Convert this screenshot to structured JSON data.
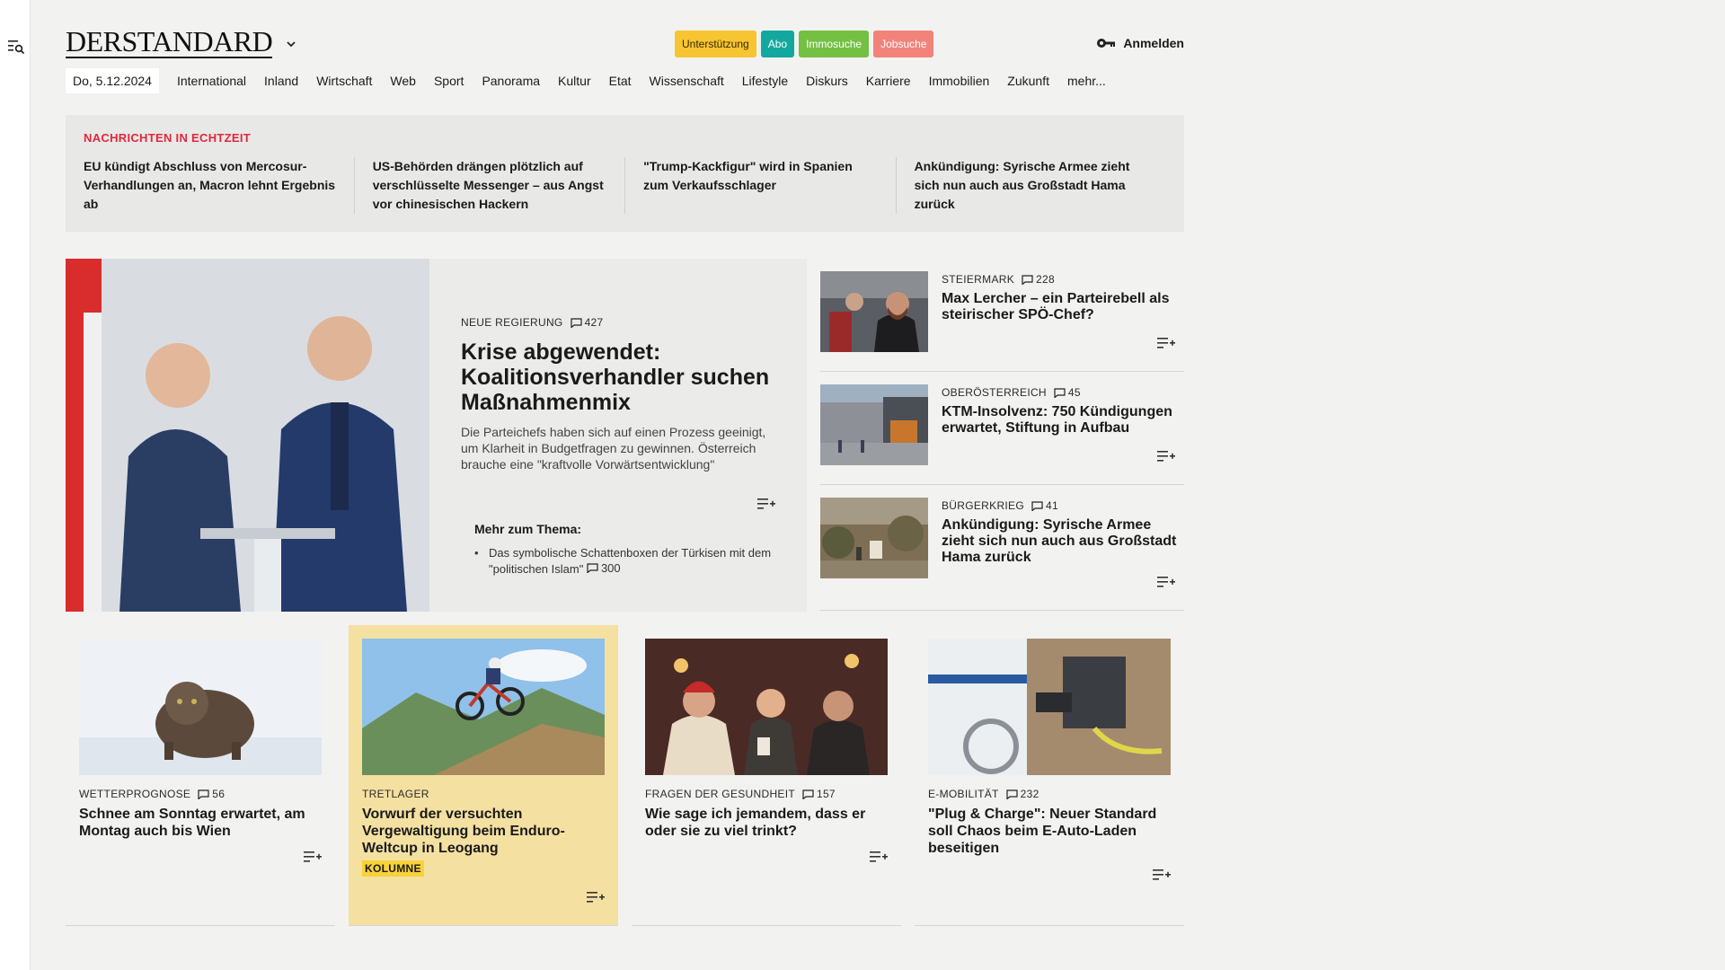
{
  "brand": {
    "logo": "DERSTANDARD"
  },
  "header": {
    "pills": [
      "Unterstützung",
      "Abo",
      "Immosuche",
      "Jobsuche"
    ],
    "login": "Anmelden"
  },
  "nav": {
    "date": "Do, 5.12.2024",
    "items": [
      "International",
      "Inland",
      "Wirtschaft",
      "Web",
      "Sport",
      "Panorama",
      "Kultur",
      "Etat",
      "Wissenschaft",
      "Lifestyle",
      "Diskurs",
      "Karriere",
      "Immobilien",
      "Zukunft",
      "mehr..."
    ]
  },
  "ticker": {
    "heading": "NACHRICHTEN IN ECHTZEIT",
    "items": [
      "EU kündigt Abschluss von Mercosur-Verhandlungen an, Macron lehnt Ergebnis ab",
      "US-Behörden drängen plötzlich auf verschlüsselte Messenger – aus Angst vor chinesischen Hackern",
      "\"Trump-Kackfigur\" wird in Spanien zum Verkaufsschlager",
      "Ankündigung: Syrische Armee zieht sich nun auch aus Großstadt Hama zurück"
    ]
  },
  "hero": {
    "kicker": "NEUE REGIERUNG",
    "comments": "427",
    "title": "Krise abgewendet: Koalitionsverhandler suchen Maßnahmenmix",
    "teaser": "Die Parteichefs haben sich auf einen Prozess geeinigt, um Klarheit in Budgetfragen zu gewinnen. Österreich brauche eine \"kraftvolle Vorwärtsentwicklung\"",
    "more_heading": "Mehr zum Thema:",
    "more_item": "Das symbolische Schattenboxen der Türkisen mit dem \"politischen Islam\"",
    "more_comments": "300"
  },
  "side": [
    {
      "kicker": "STEIERMARK",
      "comments": "228",
      "title": "Max Lercher – ein Parteirebell als steirischer SPÖ-Chef?"
    },
    {
      "kicker": "OBERÖSTERREICH",
      "comments": "45",
      "title": "KTM-Insolvenz: 750 Kündigungen erwartet, Stiftung in Aufbau"
    },
    {
      "kicker": "BÜRGERKRIEG",
      "comments": "41",
      "title": "Ankündigung: Syrische Armee zieht sich nun auch aus Großstadt Hama zurück"
    }
  ],
  "cards": [
    {
      "kicker": "WETTERPROGNOSE",
      "comments": "56",
      "title": "Schnee am Sonntag erwartet, am Montag auch bis Wien"
    },
    {
      "kicker": "TRETLAGER",
      "comments": "",
      "title": "Vorwurf der versuchten Vergewaltigung beim Enduro-Weltcup in Leogang",
      "badge": "KOLUMNE"
    },
    {
      "kicker": "FRAGEN DER GESUNDHEIT",
      "comments": "157",
      "title": "Wie sage ich jemandem, dass er oder sie zu viel trinkt?"
    },
    {
      "kicker": "E-MOBILITÄT",
      "comments": "232",
      "title": "\"Plug & Charge\": Neuer Standard soll Chaos beim E-Auto-Laden beseitigen"
    }
  ],
  "colors": {
    "ticker_accent": "#e0283c",
    "column_bg": "#f4e0a1",
    "badge": "#f7d23a"
  }
}
